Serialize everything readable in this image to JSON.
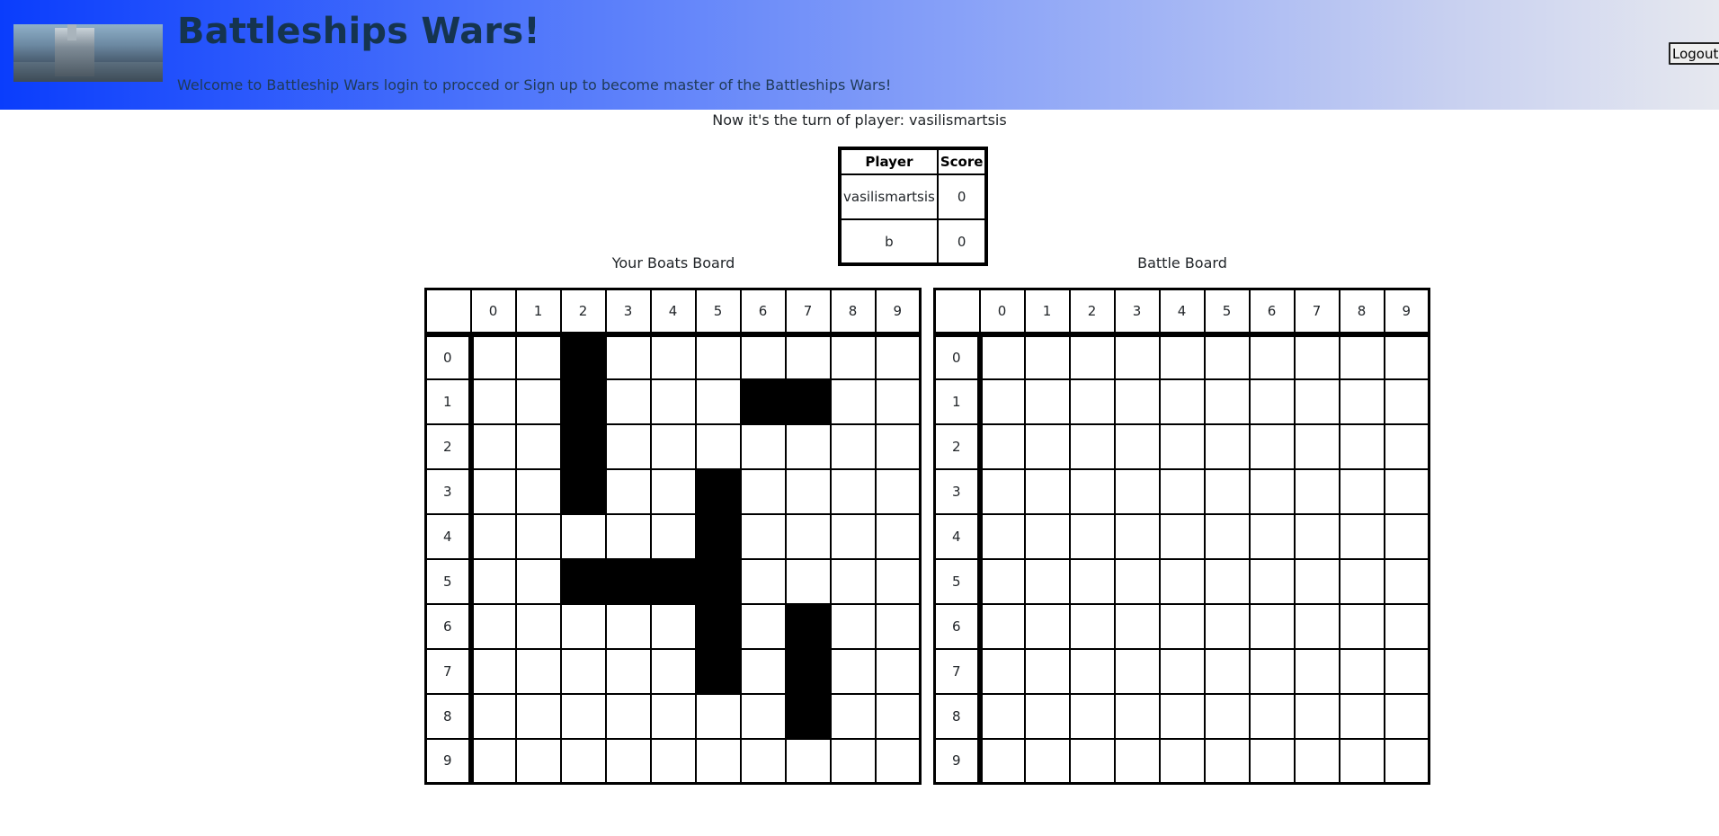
{
  "header": {
    "title": "Battleships Wars!",
    "welcome": "Welcome to Battleship Wars login to procced or Sign up to become master of the Battleships Wars!",
    "logout_label": "Logout"
  },
  "turn_text": "Now it's the turn of player: vasilismartsis",
  "scoreboard": {
    "headers": [
      "Player",
      "Score"
    ],
    "rows": [
      {
        "player": "vasilismartsis",
        "score": "0"
      },
      {
        "player": "b",
        "score": "0"
      }
    ]
  },
  "boats_board": {
    "caption": "Your Boats Board",
    "columns": [
      "0",
      "1",
      "2",
      "3",
      "4",
      "5",
      "6",
      "7",
      "8",
      "9"
    ],
    "rows": [
      "0",
      "1",
      "2",
      "3",
      "4",
      "5",
      "6",
      "7",
      "8",
      "9"
    ],
    "ships": [
      [
        0,
        2
      ],
      [
        1,
        2
      ],
      [
        2,
        2
      ],
      [
        3,
        2
      ],
      [
        1,
        6
      ],
      [
        1,
        7
      ],
      [
        3,
        5
      ],
      [
        4,
        5
      ],
      [
        5,
        5
      ],
      [
        6,
        5
      ],
      [
        7,
        5
      ],
      [
        5,
        2
      ],
      [
        5,
        3
      ],
      [
        5,
        4
      ],
      [
        6,
        7
      ],
      [
        7,
        7
      ],
      [
        8,
        7
      ]
    ]
  },
  "battle_board": {
    "caption": "Battle Board",
    "columns": [
      "0",
      "1",
      "2",
      "3",
      "4",
      "5",
      "6",
      "7",
      "8",
      "9"
    ],
    "rows": [
      "0",
      "1",
      "2",
      "3",
      "4",
      "5",
      "6",
      "7",
      "8",
      "9"
    ]
  }
}
